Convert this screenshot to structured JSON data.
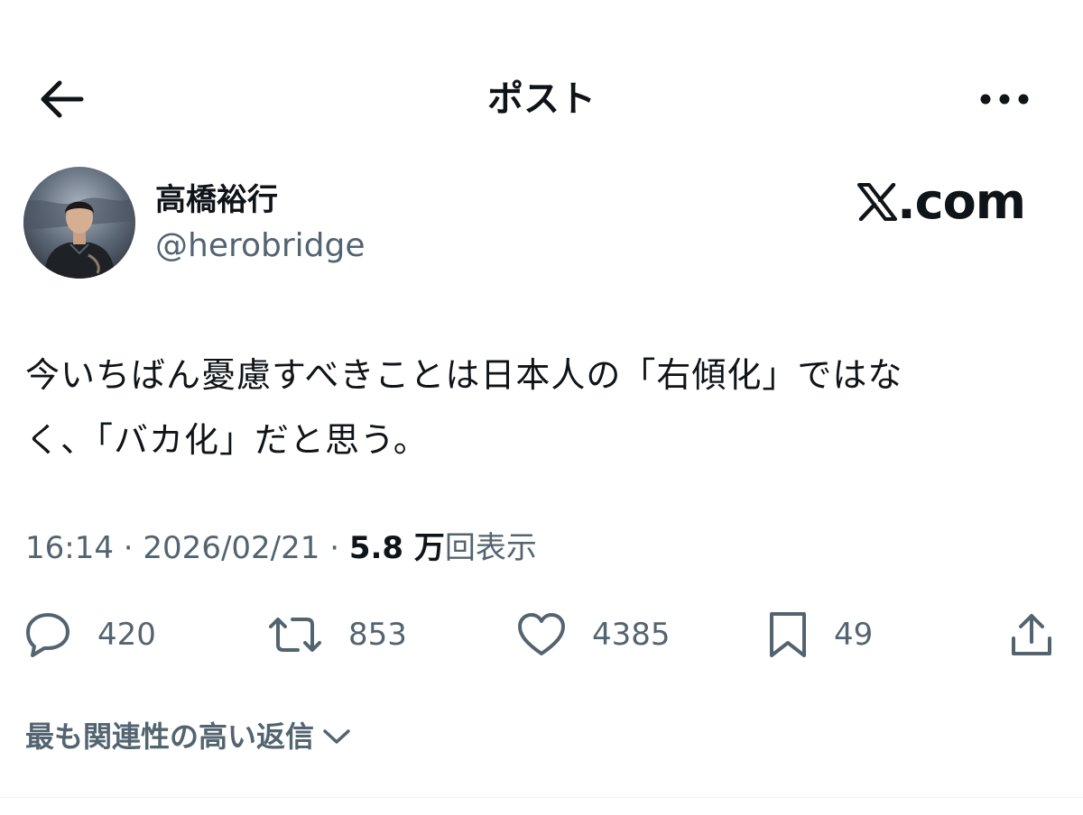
{
  "header": {
    "title": "ポスト",
    "back_icon": "arrow-left-icon",
    "more_icon": "more-horizontal-icon"
  },
  "author": {
    "display_name": "高橋裕行",
    "handle": "@herobridge"
  },
  "site_logo": {
    "mark": "𝕏",
    "suffix": ".com"
  },
  "tweet": {
    "line1": "今いちばん憂慮すべきことは日本人の「右傾化」ではな",
    "line2": "く、「バカ化」だと思う。"
  },
  "meta": {
    "time": "16:14",
    "separator": " · ",
    "date": "2026/02/21",
    "views_count": "5.8 万",
    "views_label": "回表示"
  },
  "actions": {
    "reply_count": "420",
    "retweet_count": "853",
    "like_count": "4385",
    "bookmark_count": "49"
  },
  "replies_sort": {
    "label": "最も関連性の高い返信"
  },
  "colors": {
    "text": "#0f1419",
    "secondary": "#536471",
    "divider": "#eff3f4"
  }
}
